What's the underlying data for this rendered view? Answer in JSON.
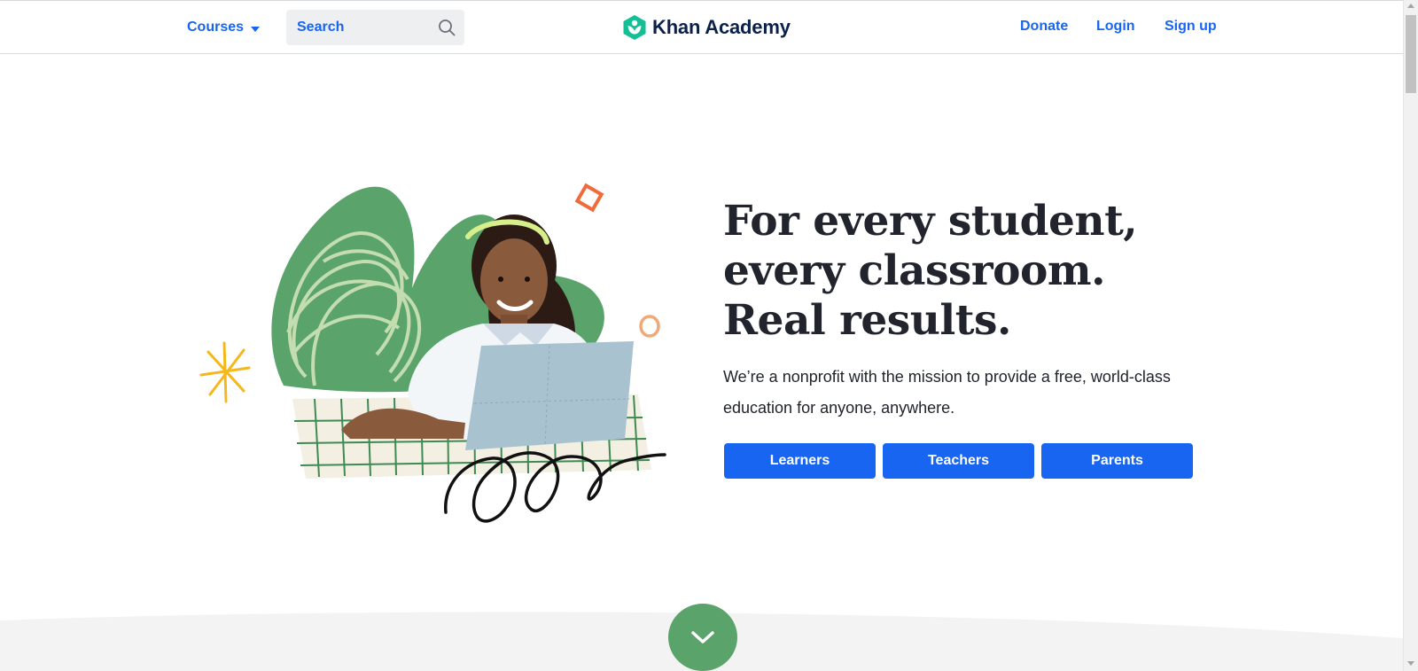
{
  "header": {
    "courses_label": "Courses",
    "search_placeholder": "Search",
    "logo_text": "Khan Academy",
    "donate_label": "Donate",
    "login_label": "Login",
    "signup_label": "Sign up"
  },
  "hero": {
    "headline_lines": [
      "For every student,",
      "every classroom.",
      "Real results."
    ],
    "subtext": "We’re a nonprofit with the mission to provide a free, world-class education for anyone, anywhere.",
    "buttons": [
      "Learners",
      "Teachers",
      "Parents"
    ]
  },
  "colors": {
    "accent": "#1865f2",
    "logo_green": "#14bf96",
    "scroll_cta": "#5aa46b",
    "text": "#21242c"
  },
  "icons": {
    "search": "search-icon",
    "caret": "chevron-down-icon",
    "scroll_cta": "chevron-down-icon",
    "logo": "khan-academy-logo-icon"
  }
}
